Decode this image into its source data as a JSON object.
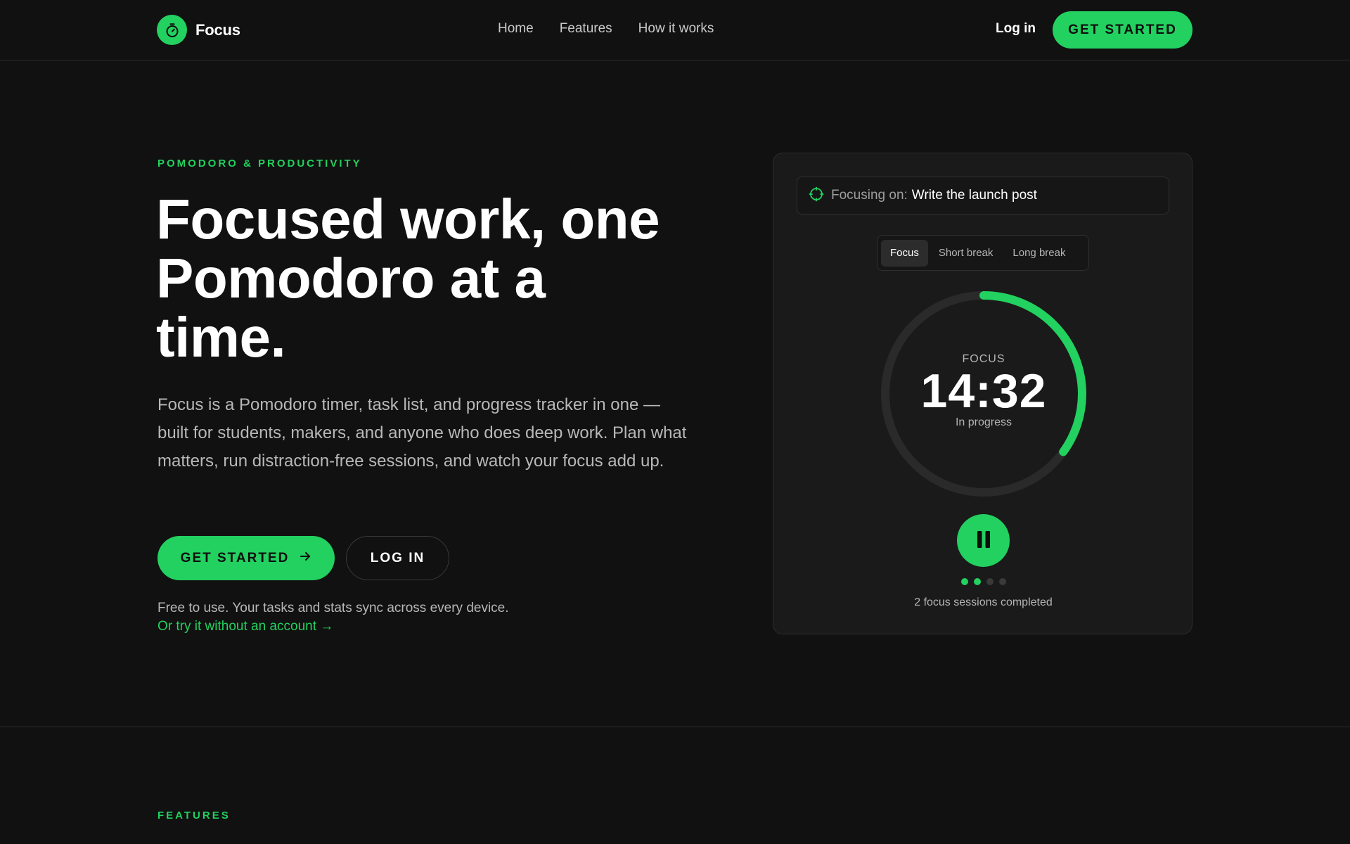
{
  "nav": {
    "brand": "Focus",
    "links": [
      "Home",
      "Features",
      "How it works"
    ],
    "login": "Log in",
    "cta": "GET STARTED"
  },
  "hero": {
    "eyebrow": "POMODORO & PRODUCTIVITY",
    "title_lines": [
      "Focused work, one",
      "Pomodoro at a",
      "time."
    ],
    "description": "Focus is a Pomodoro timer, task list, and progress tracker in one — built for students, makers, and anyone who does deep work. Plan what matters, run distraction-free sessions, and watch your focus add up.",
    "primary_button": "GET STARTED",
    "secondary_button": "LOG IN",
    "note": "Free to use. Your tasks and stats sync across every device.",
    "try_link": "Or try it without an account →"
  },
  "timer_card": {
    "focusing_label": "Focusing on:",
    "focusing_task": "Write the launch post",
    "tabs": [
      "Focus",
      "Short break",
      "Long break"
    ],
    "active_tab": "Focus",
    "mode_label": "FOCUS",
    "time": "14:32",
    "status": "In progress",
    "progress_fraction": 0.35,
    "sessions_done": 2,
    "sessions_total": 4,
    "sessions_text": "2 focus sessions completed"
  },
  "features": {
    "eyebrow": "FEATURES"
  },
  "colors": {
    "accent": "#22d15f",
    "background": "#111111",
    "card": "#1a1a1a",
    "track": "#2a2a2a"
  },
  "icons": {
    "brand": "stopwatch-icon",
    "arrow": "arrow-right-icon",
    "target": "crosshair-icon",
    "pause": "pause-icon"
  }
}
